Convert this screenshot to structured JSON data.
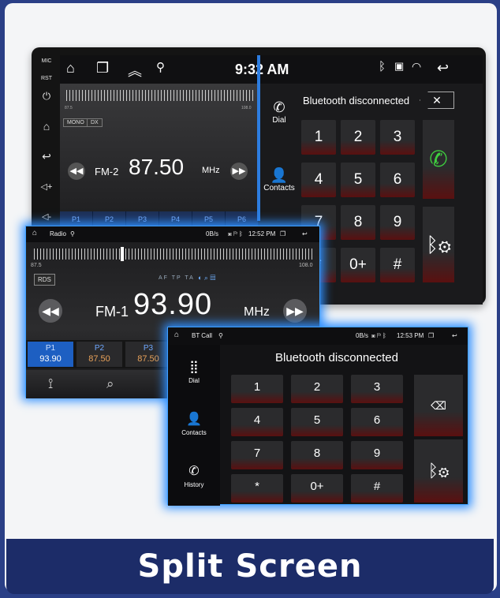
{
  "banner": {
    "title": "Split Screen"
  },
  "back_device": {
    "hard_keys": [
      "MIC",
      "RST",
      "⏻",
      "⌂",
      "↩",
      "◁+",
      "◁-"
    ],
    "status": {
      "time": "9:32 AM"
    },
    "radio": {
      "tags": [
        "MONO",
        "DX"
      ],
      "band": "FM-2",
      "frequency": "87.50",
      "unit": "MHz",
      "scale_min": "87.5",
      "scale_max": "108.0",
      "presets": [
        "P1",
        "P2",
        "P3",
        "P4",
        "P5",
        "P6"
      ]
    },
    "dialer": {
      "tabs": [
        "Dial",
        "Contacts"
      ],
      "message": "Bluetooth disconnected",
      "keys": [
        "1",
        "2",
        "3",
        "4",
        "5",
        "6",
        "7",
        "8",
        "9",
        "*",
        "0+",
        "#"
      ]
    }
  },
  "radio_window": {
    "status": {
      "app": "Radio",
      "net": "0B/s",
      "time": "12:52 PM"
    },
    "scale_min": "87.5",
    "scale_max": "108.0",
    "rds": "RDS",
    "flags": "AF TP TA",
    "band": "FM-1",
    "frequency": "93.90",
    "unit": "MHz",
    "tuning_fraction": 0.31,
    "presets": [
      {
        "name": "P1",
        "freq": "93.90",
        "active": true
      },
      {
        "name": "P2",
        "freq": "87.50",
        "active": false
      },
      {
        "name": "P3",
        "freq": "87.50",
        "active": false
      }
    ]
  },
  "call_window": {
    "status": {
      "app": "BT Call",
      "net": "0B/s",
      "time": "12:53 PM"
    },
    "tabs": [
      "Dial",
      "Contacts",
      "History"
    ],
    "message": "Bluetooth disconnected",
    "keys": [
      "1",
      "2",
      "3",
      "4",
      "5",
      "6",
      "7",
      "8",
      "9",
      "*",
      "0+",
      "#"
    ]
  },
  "colors": {
    "accent_glow": "#2f8fff",
    "banner_bg": "#1c2c68",
    "preset_freq": "#e8a25a"
  }
}
